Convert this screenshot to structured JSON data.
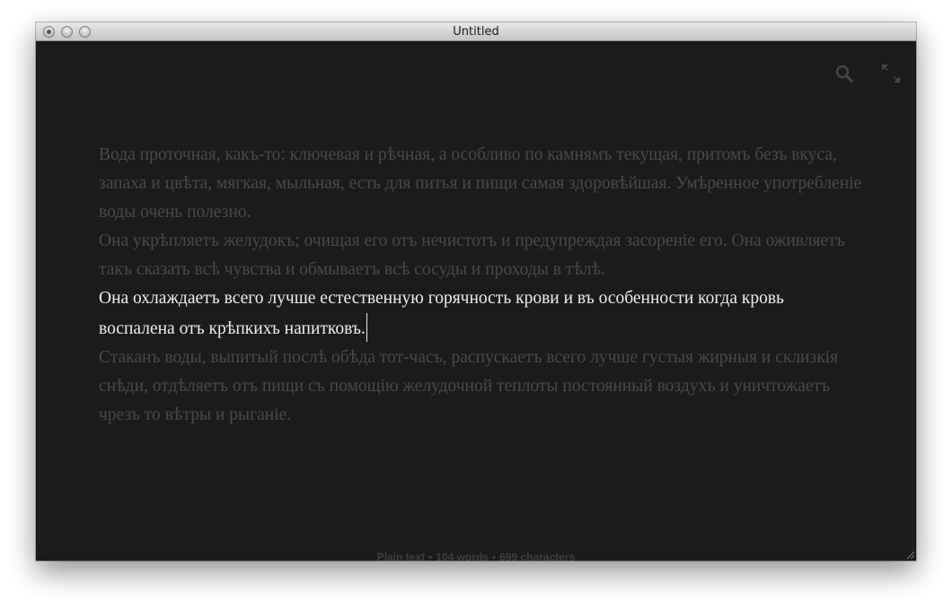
{
  "window": {
    "title": "Untitled"
  },
  "toolbar": {
    "search_icon": "magnifier-icon",
    "fullscreen_icon": "fullscreen-arrows-icon"
  },
  "document": {
    "paragraphs": [
      "Вода проточная, какъ-то: ключевая и рѣчная, а особливо по камнямъ текущая, притомъ безъ вкуса, запаха и цвѣта, мягкая, мыльная, есть для питья и пищи самая здоровѣйшая. Умѣренное употребленіе воды очень полезно.",
      "Она укрѣпляетъ желудокъ; очищая его отъ нечистотъ и предупреждая засореніе его. Она оживляетъ такъ сказать всѣ чувства и обмываетъ всѣ сосуды и проходы в тѣлѣ.",
      "Она охлаждаетъ всего лучше естественную горячность крови и въ особенности когда кровь воспалена отъ крѣпкихъ напитковъ.",
      "Стаканъ воды, выпитый послѣ обѣда тот-часъ, распускаетъ всего лучше густыя жирныя и склизкія снѣди, отдѣляетъ отъ пищи съ помощію желудочной теплоты постоянный воздухъ и уничтожаетъ чрезъ то вѣтры и рыганіе."
    ],
    "focused_paragraph_index": 2
  },
  "status": {
    "format": "Plain text",
    "words": "104 words",
    "characters": "699 characters",
    "separator": "•"
  },
  "colors": {
    "background": "#1b1b1c",
    "dim_text": "#4a4a4a",
    "focus_text": "#eeeeee",
    "status_text": "#3f3f3f"
  }
}
